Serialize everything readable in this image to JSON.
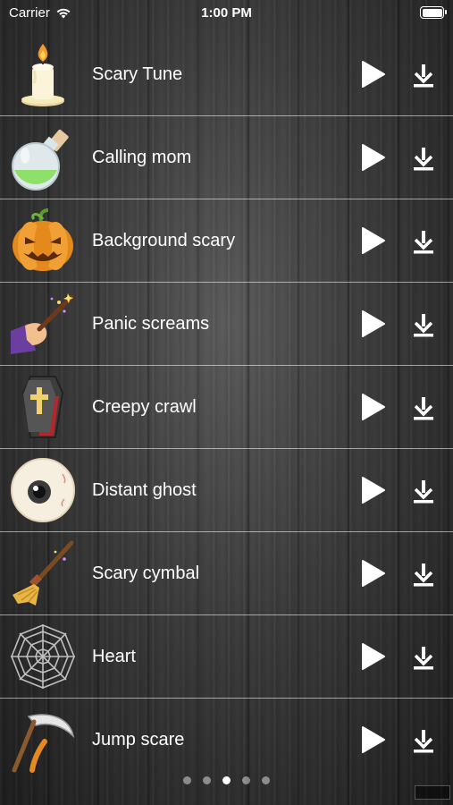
{
  "status_bar": {
    "carrier": "Carrier",
    "time": "1:00 PM",
    "battery_level": 1.0
  },
  "sounds": [
    {
      "label": "Scary Tune",
      "icon": "candle-icon"
    },
    {
      "label": "Calling mom",
      "icon": "potion-flask-icon"
    },
    {
      "label": "Background scary",
      "icon": "pumpkin-icon"
    },
    {
      "label": "Panic screams",
      "icon": "magic-wand-icon"
    },
    {
      "label": "Creepy crawl",
      "icon": "coffin-icon"
    },
    {
      "label": "Distant ghost",
      "icon": "eyeball-icon"
    },
    {
      "label": "Scary cymbal",
      "icon": "witch-broom-icon"
    },
    {
      "label": "Heart",
      "icon": "spider-web-icon"
    },
    {
      "label": "Jump scare",
      "icon": "scythe-icon"
    }
  ],
  "pagination": {
    "page_count": 5,
    "current_page": 3
  },
  "colors": {
    "text": "#ffffff",
    "divider": "#8a8a8a",
    "background": "#3a3a3a"
  }
}
